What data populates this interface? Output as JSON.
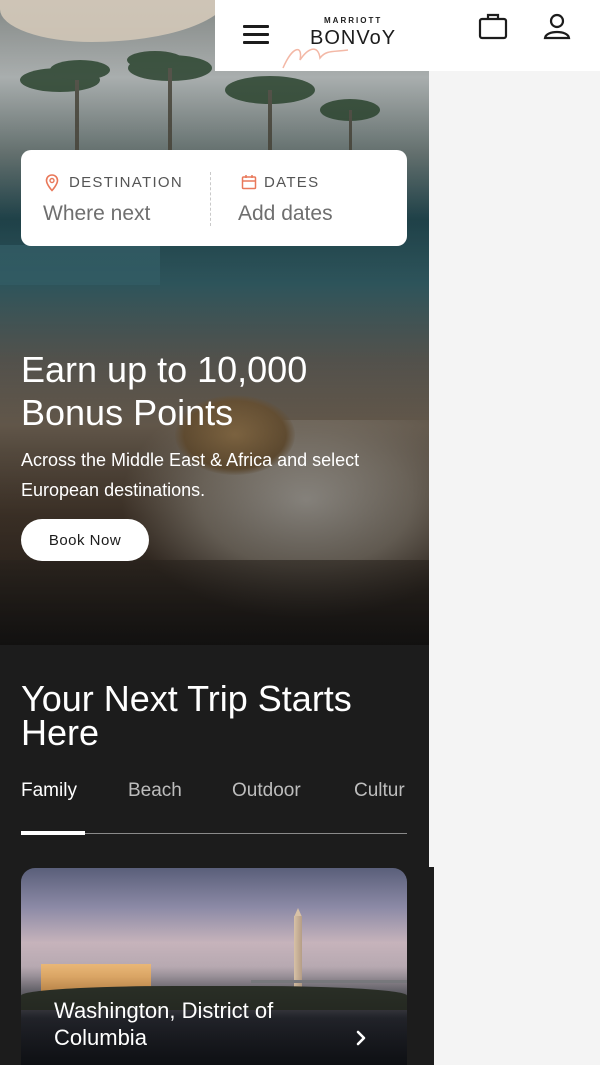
{
  "header": {
    "logo_top": "MARRIOTT",
    "logo_main": "BONVoY"
  },
  "search": {
    "destination_label": "DESTINATION",
    "destination_placeholder": "Where next",
    "dates_label": "DATES",
    "dates_placeholder": "Add dates"
  },
  "promo": {
    "title": "Earn up to 10,000 Bonus Points",
    "subtitle": "Across the Middle East & Africa and select European destinations.",
    "button": "Book Now"
  },
  "trips": {
    "title": "Your Next Trip Starts Here",
    "tabs": [
      "Family",
      "Beach",
      "Outdoor",
      "Cultur"
    ],
    "active_tab": "Family",
    "card": {
      "title": "Washington, District of Columbia"
    }
  },
  "colors": {
    "accent": "#e9785a",
    "dark_bg": "#1c1c1c",
    "header_bg": "#ffffff"
  },
  "icons": {
    "menu": "hamburger-menu-icon",
    "bag": "briefcase-icon",
    "account": "user-icon",
    "destination": "map-pin-icon",
    "dates": "calendar-icon",
    "card_arrow": "chevron-right-icon"
  }
}
